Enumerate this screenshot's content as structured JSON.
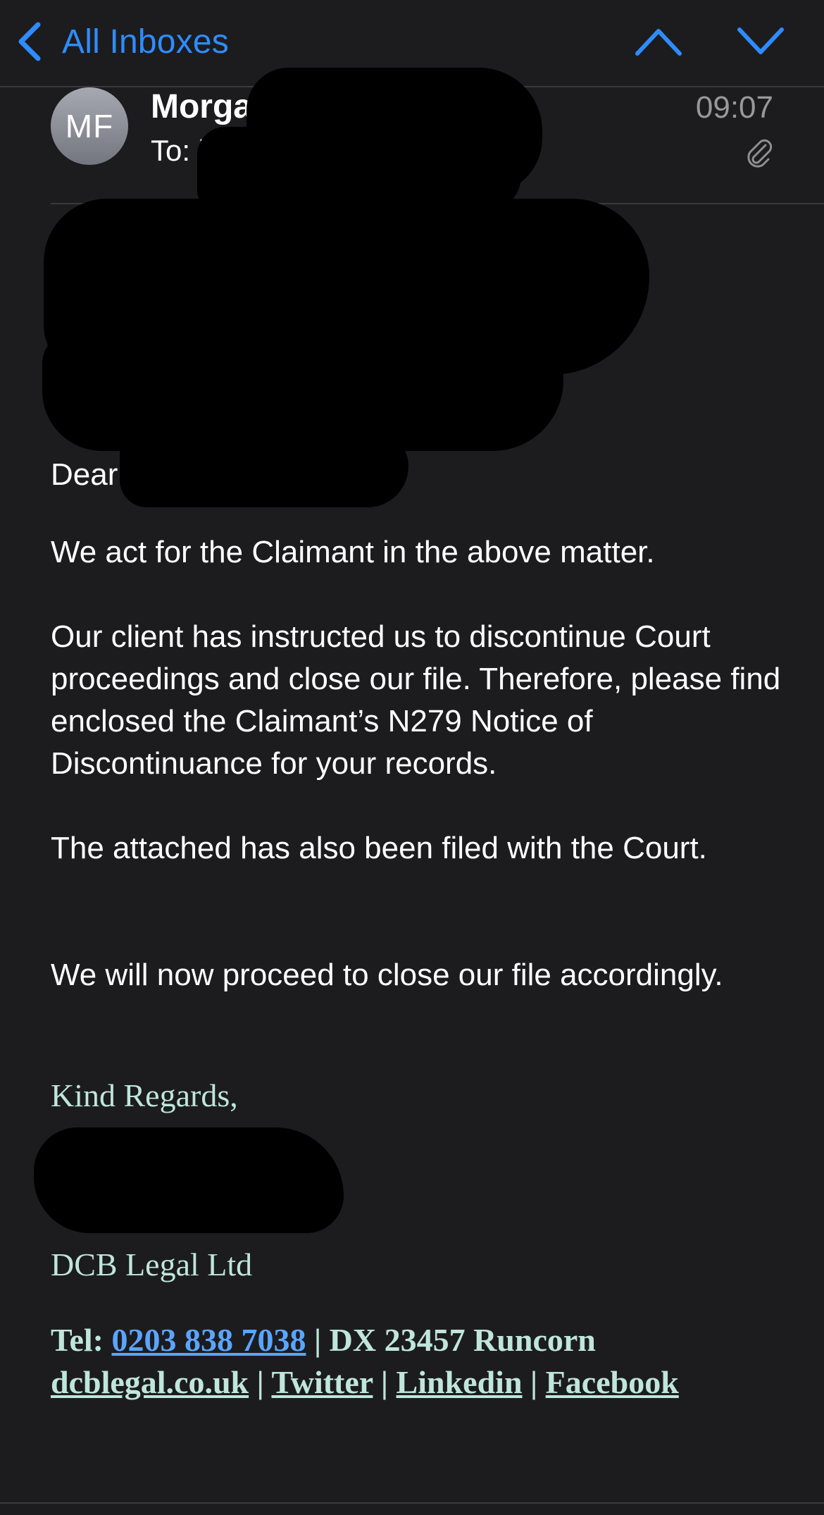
{
  "nav": {
    "back_label": "All Inboxes"
  },
  "message": {
    "avatar_initials": "MF",
    "sender": "Morgan",
    "to_label": "To: j",
    "time": "09:07"
  },
  "body": {
    "greeting": "Dear",
    "paragraphs": [
      "We act for the Claimant in the above matter.",
      "Our client has instructed us to discontinue Court proceedings and close our file. Therefore, please find enclosed the Claimant’s N279 Notice of Discontinuance for your records.",
      "The attached has also been filed with the Court.",
      "We will now proceed to close our file accordingly."
    ]
  },
  "signature": {
    "closing": "Kind Regards,",
    "company": "DCB Legal Ltd",
    "tel_label": "Tel:",
    "tel_number": "0203 838 7038",
    "separator": "|",
    "dx": "DX 23457 Runcorn",
    "website": "dcblegal.co.uk",
    "twitter": "Twitter",
    "linkedin": "Linkedin",
    "facebook": "Facebook"
  },
  "colors": {
    "background": "#1c1c1e",
    "accent_blue": "#2f8cff",
    "signature_green": "#bfe6d9",
    "secondary_text": "#98989d"
  },
  "icons": [
    "back-chevron-icon",
    "chevron-up-icon",
    "chevron-down-icon",
    "attachment-icon",
    "chevron-right-icon"
  ]
}
